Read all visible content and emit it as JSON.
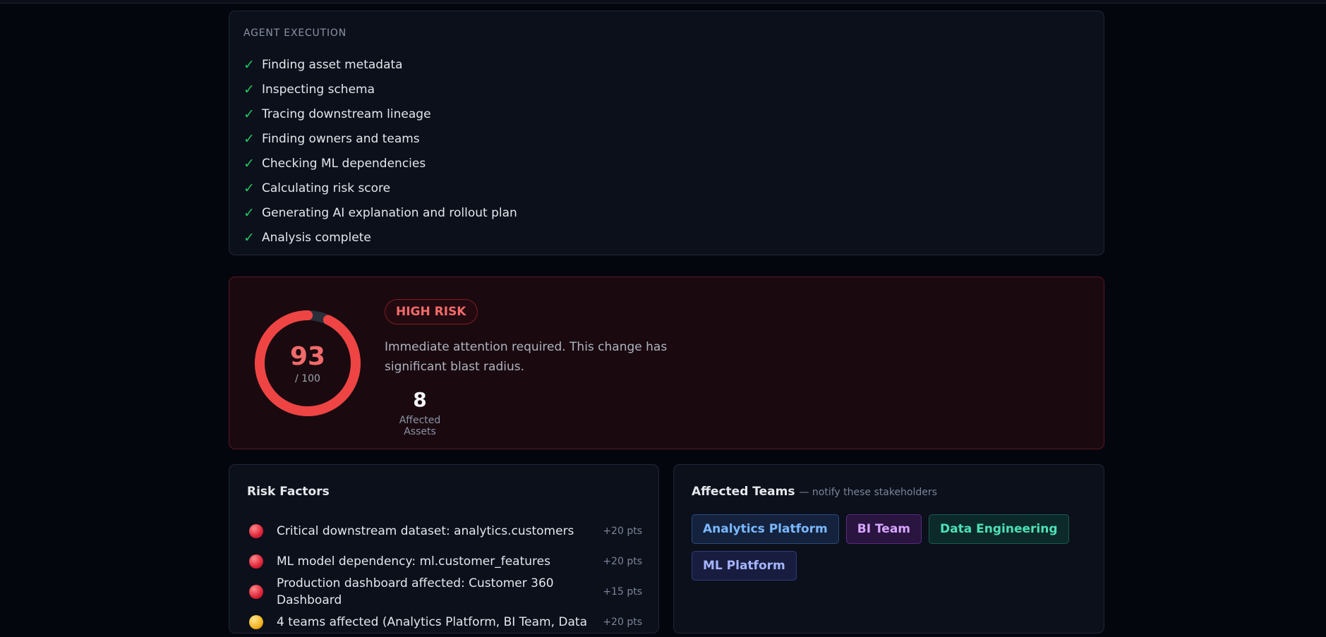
{
  "execution": {
    "title": "AGENT EXECUTION",
    "steps": [
      {
        "label": "Finding asset metadata",
        "status": "done"
      },
      {
        "label": "Inspecting schema",
        "status": "done"
      },
      {
        "label": "Tracing downstream lineage",
        "status": "done"
      },
      {
        "label": "Finding owners and teams",
        "status": "done"
      },
      {
        "label": "Checking ML dependencies",
        "status": "done"
      },
      {
        "label": "Calculating risk score",
        "status": "done"
      },
      {
        "label": "Generating AI explanation and rollout plan",
        "status": "done"
      },
      {
        "label": "Analysis complete",
        "status": "done"
      }
    ],
    "check_symbol": "✓"
  },
  "risk": {
    "score": "93",
    "score_max": "/ 100",
    "score_fraction": 0.93,
    "level": "HIGH RISK",
    "description": "Immediate attention required. This change has significant blast radius.",
    "affected_count": "8",
    "affected_label": "Affected Assets",
    "accent_color": "#ef4444"
  },
  "factors": {
    "title": "Risk Factors",
    "items": [
      {
        "text": "Critical downstream dataset: analytics.customers",
        "points": "+20 pts",
        "severity": "red"
      },
      {
        "text": "ML model dependency: ml.customer_features",
        "points": "+20 pts",
        "severity": "red"
      },
      {
        "text": "Production dashboard affected: Customer 360 Dashboard",
        "points": "+15 pts",
        "severity": "red"
      },
      {
        "text": "4 teams affected (Analytics Platform, BI Team, Data",
        "points": "+20 pts",
        "severity": "yellow"
      }
    ]
  },
  "teams": {
    "title": "Affected Teams",
    "subtitle": "— notify these stakeholders",
    "items": [
      {
        "name": "Analytics Platform",
        "color": "#7ab8ff",
        "bg": "#14223d",
        "border": "#2a4a7a"
      },
      {
        "name": "BI Team",
        "color": "#d8a6ff",
        "bg": "#2a1440",
        "border": "#5a2a80"
      },
      {
        "name": "Data Engineering",
        "color": "#4fe0b5",
        "bg": "#0c2a2a",
        "border": "#1d5a4f"
      },
      {
        "name": "ML Platform",
        "color": "#a5b4fc",
        "bg": "#181d3f",
        "border": "#333a7a"
      }
    ]
  }
}
